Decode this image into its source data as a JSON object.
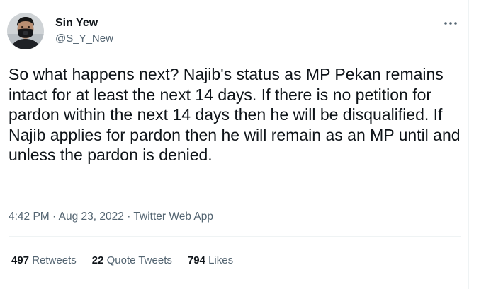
{
  "author": {
    "display_name": "Sin Yew",
    "handle": "@S_Y_New",
    "avatar_icon": "person-masked-avatar"
  },
  "more_icon": "more-horizontal-icon",
  "tweet": {
    "text": "So what happens next? Najib's status as MP Pekan remains intact for at least the next 14 days. If there is no petition for pardon within the next 14 days then he will be disqualified. If Najib applies for pardon then he will remain as an MP until and unless the pardon is denied."
  },
  "meta": {
    "time": "4:42 PM",
    "separator": "·",
    "date": "Aug 23, 2022",
    "source": "Twitter Web App"
  },
  "stats": {
    "retweets": {
      "count": "497",
      "label": "Retweets"
    },
    "quotes": {
      "count": "22",
      "label": "Quote Tweets"
    },
    "likes": {
      "count": "794",
      "label": "Likes"
    }
  },
  "colors": {
    "text_primary": "#0f1419",
    "text_secondary": "#536471",
    "divider": "#eff3f4"
  }
}
